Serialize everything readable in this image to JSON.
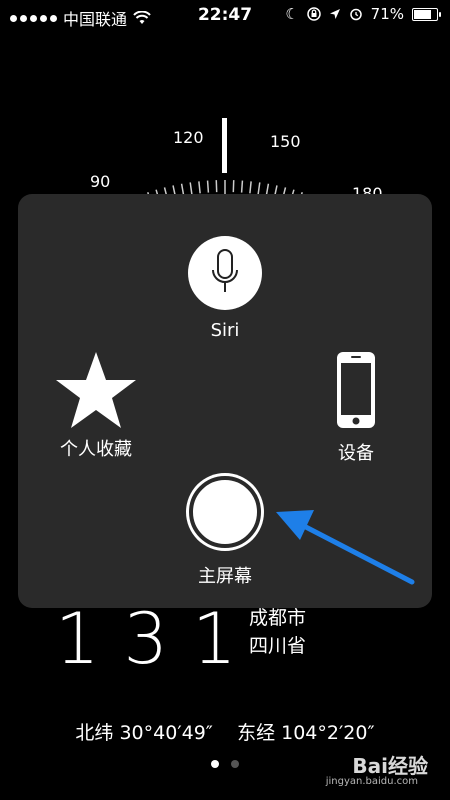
{
  "status_bar": {
    "carrier": "中国联通",
    "time": "22:47",
    "battery": "71%"
  },
  "compass": {
    "labels": [
      "90",
      "120",
      "150",
      "180"
    ]
  },
  "panel": {
    "siri_label": "Siri",
    "favorites_label": "个人收藏",
    "device_label": "设备",
    "home_label": "主屏幕"
  },
  "background": {
    "heading_digits": "131",
    "city": "成都市",
    "province": "四川省",
    "latitude": "北纬 30°40′49″",
    "longitude": "东经 104°2′20″"
  },
  "watermark": {
    "brand": "Bai经验",
    "url": "jingyan.baidu.com"
  },
  "colors": {
    "panel_bg": "#2a2a2a",
    "arrow": "#1e7fe8"
  }
}
